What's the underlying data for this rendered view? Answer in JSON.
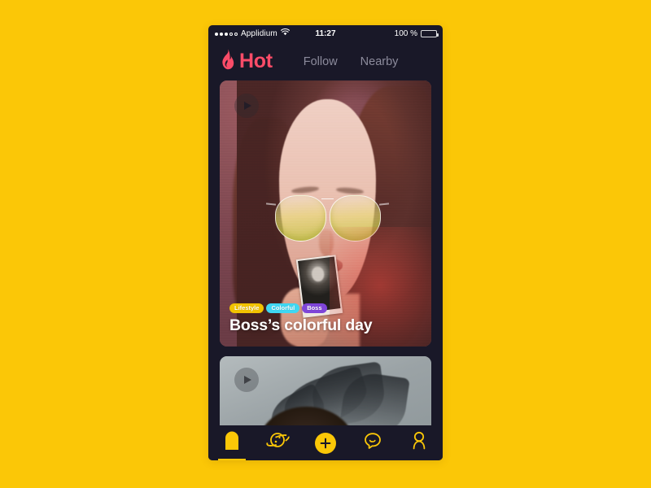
{
  "background_color": "#FBC707",
  "phone": {
    "screen_bg": "#191828",
    "status_bar": {
      "carrier": "Applidium",
      "signal_filled_dots": 3,
      "signal_empty_dots": 2,
      "wifi_icon": "wifi-icon",
      "time": "11:27",
      "battery_percent": "100 %",
      "battery_icon": "battery-full-icon"
    },
    "top_nav": {
      "brand_icon": "flame-icon",
      "brand_label": "Hot",
      "brand_color": "#FB4C68",
      "links": [
        {
          "label": "Follow",
          "active": false
        },
        {
          "label": "Nearby",
          "active": false
        }
      ],
      "link_color": "#8C8B9C"
    },
    "feed": {
      "cards": [
        {
          "play_icon": "play-icon",
          "title": "Boss’s colorful day",
          "tags": [
            {
              "label": "Lifestyle",
              "color": "#F2C300"
            },
            {
              "label": "Colorful",
              "color": "#3FD7F2"
            },
            {
              "label": "Boss",
              "color": "#7E45D8"
            }
          ]
        },
        {
          "play_icon": "play-icon",
          "title": "",
          "tags": []
        }
      ]
    },
    "tab_bar": {
      "accent_color": "#FBC707",
      "items": [
        {
          "name": "home",
          "icon": "home-tag-icon",
          "active": true
        },
        {
          "name": "discover",
          "icon": "planet-icon",
          "active": false
        },
        {
          "name": "create",
          "icon": "plus-icon",
          "active": false
        },
        {
          "name": "messages",
          "icon": "chat-bubble-icon",
          "active": false
        },
        {
          "name": "profile",
          "icon": "person-icon",
          "active": false
        }
      ]
    }
  }
}
